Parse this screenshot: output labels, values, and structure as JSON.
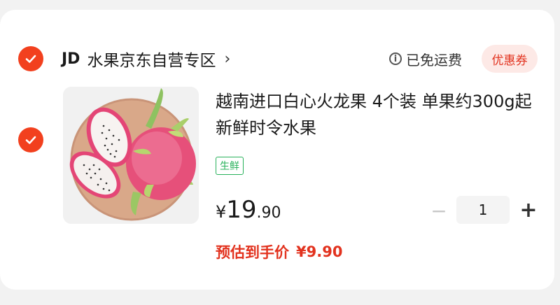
{
  "store": {
    "logo": "JD",
    "name": "水果京东自营专区",
    "chevron": "›",
    "shipping_text": "已免运费",
    "coupon_label": "优惠券"
  },
  "product": {
    "title": "越南进口白心火龙果 4个装 单果约300g起 新鲜时令水果",
    "tag": "生鲜",
    "price_currency": "¥",
    "price_integer": "19",
    "price_decimal": ".90",
    "quantity": "1",
    "estimate_label": "预估到手价",
    "estimate_price": "¥9.90",
    "image_icon": "dragon-fruit-image"
  },
  "icons": {
    "check": "check-icon",
    "info": "info-icon",
    "minus": "minus-icon",
    "plus": "plus-icon",
    "minus_glyph": "−",
    "plus_glyph": "+",
    "info_glyph": "i"
  },
  "colors": {
    "accent": "#f2401e",
    "price_red": "#e2321e",
    "fresh_green": "#27b15a",
    "coupon_bg": "#fde9e6"
  }
}
